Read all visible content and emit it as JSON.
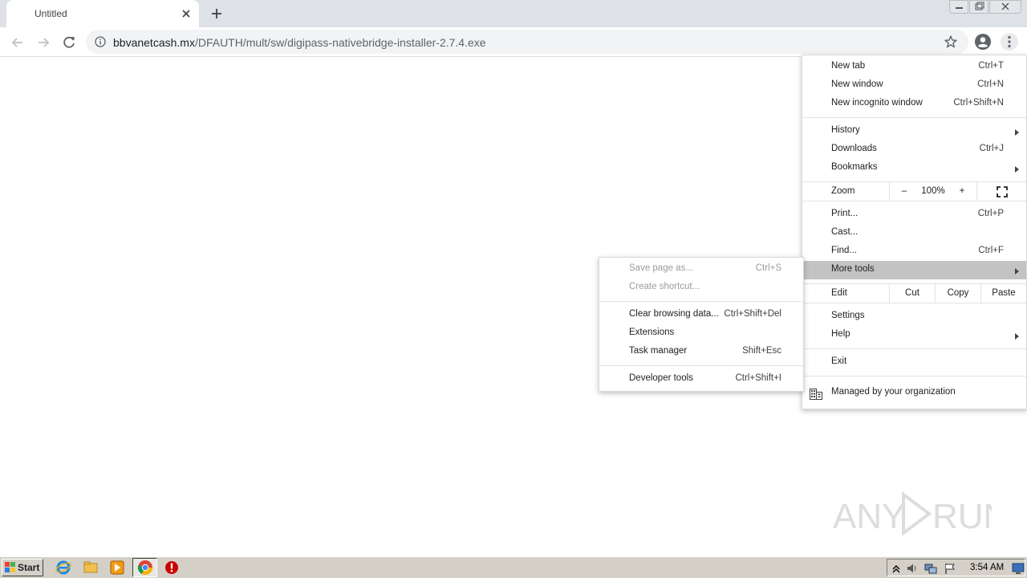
{
  "tab": {
    "title": "Untitled"
  },
  "address": {
    "host": "bbvanetcash.mx",
    "path": "/DFAUTH/mult/sw/digipass-nativebridge-installer-2.7.4.exe"
  },
  "menu": {
    "new_tab": {
      "label": "New tab",
      "shortcut": "Ctrl+T"
    },
    "new_window": {
      "label": "New window",
      "shortcut": "Ctrl+N"
    },
    "new_incognito": {
      "label": "New incognito window",
      "shortcut": "Ctrl+Shift+N"
    },
    "history": {
      "label": "History"
    },
    "downloads": {
      "label": "Downloads",
      "shortcut": "Ctrl+J"
    },
    "bookmarks": {
      "label": "Bookmarks"
    },
    "zoom": {
      "label": "Zoom",
      "minus": "–",
      "value": "100%",
      "plus": "+"
    },
    "print": {
      "label": "Print...",
      "shortcut": "Ctrl+P"
    },
    "cast": {
      "label": "Cast..."
    },
    "find": {
      "label": "Find...",
      "shortcut": "Ctrl+F"
    },
    "more_tools": {
      "label": "More tools"
    },
    "edit": {
      "label": "Edit",
      "cut": "Cut",
      "copy": "Copy",
      "paste": "Paste"
    },
    "settings": {
      "label": "Settings"
    },
    "help": {
      "label": "Help"
    },
    "exit": {
      "label": "Exit"
    },
    "managed": {
      "label": "Managed by your organization"
    }
  },
  "submenu": {
    "save_page": {
      "label": "Save page as...",
      "shortcut": "Ctrl+S"
    },
    "create_shortcut": {
      "label": "Create shortcut..."
    },
    "clear_data": {
      "label": "Clear browsing data...",
      "shortcut": "Ctrl+Shift+Del"
    },
    "extensions": {
      "label": "Extensions"
    },
    "task_manager": {
      "label": "Task manager",
      "shortcut": "Shift+Esc"
    },
    "dev_tools": {
      "label": "Developer tools",
      "shortcut": "Ctrl+Shift+I"
    }
  },
  "watermark": {
    "text": "ANY RUN"
  },
  "taskbar": {
    "start": "Start",
    "clock": "3:54 AM"
  },
  "colors": {
    "accent_red": "#cc0000",
    "menu_highlight": "#c3c3c3"
  }
}
